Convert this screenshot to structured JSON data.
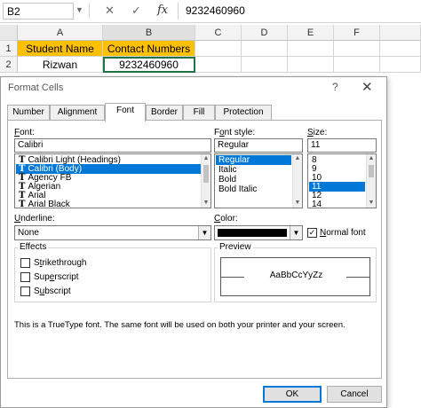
{
  "formula_bar": {
    "cell_ref": "B2",
    "cancel_icon": "x-icon",
    "enter_icon": "checkmark-icon",
    "fx_label": "fx",
    "content": "9232460960"
  },
  "sheet": {
    "columns": [
      "A",
      "B",
      "C",
      "D",
      "E",
      "F"
    ],
    "rows": [
      {
        "num": "1",
        "cells": [
          "Student Name",
          "Contact Numbers"
        ]
      },
      {
        "num": "2",
        "cells": [
          "Rizwan",
          "9232460960"
        ]
      }
    ],
    "header_fill": "#ffc000"
  },
  "dialog": {
    "title": "Format Cells",
    "help_label": "?",
    "close_label": "✕",
    "tabs": [
      {
        "label": "Number"
      },
      {
        "label": "Alignment"
      },
      {
        "label": "Font"
      },
      {
        "label": "Border"
      },
      {
        "label": "Fill"
      },
      {
        "label": "Protection"
      }
    ],
    "active_tab": "Font",
    "font": {
      "label": "Font:",
      "value": "Calibri",
      "options": [
        "Calibri Light (Headings)",
        "Calibri (Body)",
        "Agency FB",
        "Algerian",
        "Arial",
        "Arial Black"
      ],
      "selected": "Calibri (Body)"
    },
    "font_style": {
      "label": "Font style:",
      "value": "Regular",
      "options": [
        "Regular",
        "Italic",
        "Bold",
        "Bold Italic"
      ],
      "selected": "Regular"
    },
    "size": {
      "label": "Size:",
      "value": "11",
      "options": [
        "8",
        "9",
        "10",
        "11",
        "12",
        "14"
      ],
      "selected": "11"
    },
    "underline": {
      "label": "Underline:",
      "value": "None"
    },
    "color": {
      "label": "Color:",
      "swatch": "#000000",
      "normal_font_label": "Normal font",
      "normal_font_checked": true
    },
    "effects": {
      "label": "Effects",
      "items": [
        {
          "label": "Strikethrough",
          "checked": false
        },
        {
          "label": "Superscript",
          "checked": false
        },
        {
          "label": "Subscript",
          "checked": false
        }
      ]
    },
    "preview": {
      "label": "Preview",
      "sample": "AaBbCcYyZz"
    },
    "note": "This is a TrueType font.  The same font will be used on both your printer and your screen.",
    "ok_label": "OK",
    "cancel_label": "Cancel",
    "accent": "#0078d7"
  }
}
